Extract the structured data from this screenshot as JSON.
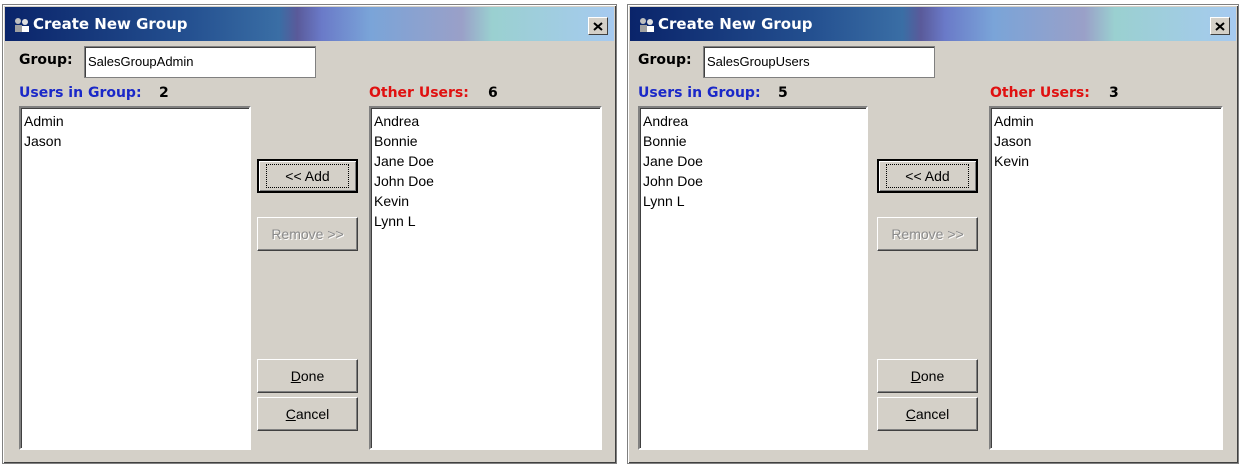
{
  "dialogs": [
    {
      "title": "Create New Group",
      "group_label": "Group:",
      "group_value": "SalesGroupAdmin",
      "users_in_group_label": "Users in Group:",
      "users_in_group_count": "2",
      "other_users_label": "Other Users:",
      "other_users_count": "6",
      "users_in_group": [
        "Admin",
        "Jason"
      ],
      "other_users": [
        "Andrea",
        "Bonnie",
        "Jane Doe",
        "John Doe",
        "Kevin",
        "Lynn L"
      ],
      "add_button": "<< Add",
      "remove_button": "Remove >>",
      "done_button": {
        "mnemonic": "D",
        "rest": "one"
      },
      "cancel_button": {
        "mnemonic": "C",
        "rest": "ancel"
      }
    },
    {
      "title": "Create New Group",
      "group_label": "Group:",
      "group_value": "SalesGroupUsers",
      "users_in_group_label": "Users in Group:",
      "users_in_group_count": "5",
      "other_users_label": "Other Users:",
      "other_users_count": "3",
      "users_in_group": [
        "Andrea",
        "Bonnie",
        "Jane Doe",
        "John Doe",
        "Lynn L"
      ],
      "other_users": [
        "Admin",
        "Jason",
        "Kevin"
      ],
      "add_button": "<< Add",
      "remove_button": "Remove >>",
      "done_button": {
        "mnemonic": "D",
        "rest": "one"
      },
      "cancel_button": {
        "mnemonic": "C",
        "rest": "ancel"
      }
    }
  ],
  "colors": {
    "users_in_group_label": "#1a28c8",
    "other_users_label": "#e01010",
    "dialog_face": "#d4d0c8"
  },
  "icons": {
    "title": "users-group-icon",
    "close": "close-icon"
  }
}
